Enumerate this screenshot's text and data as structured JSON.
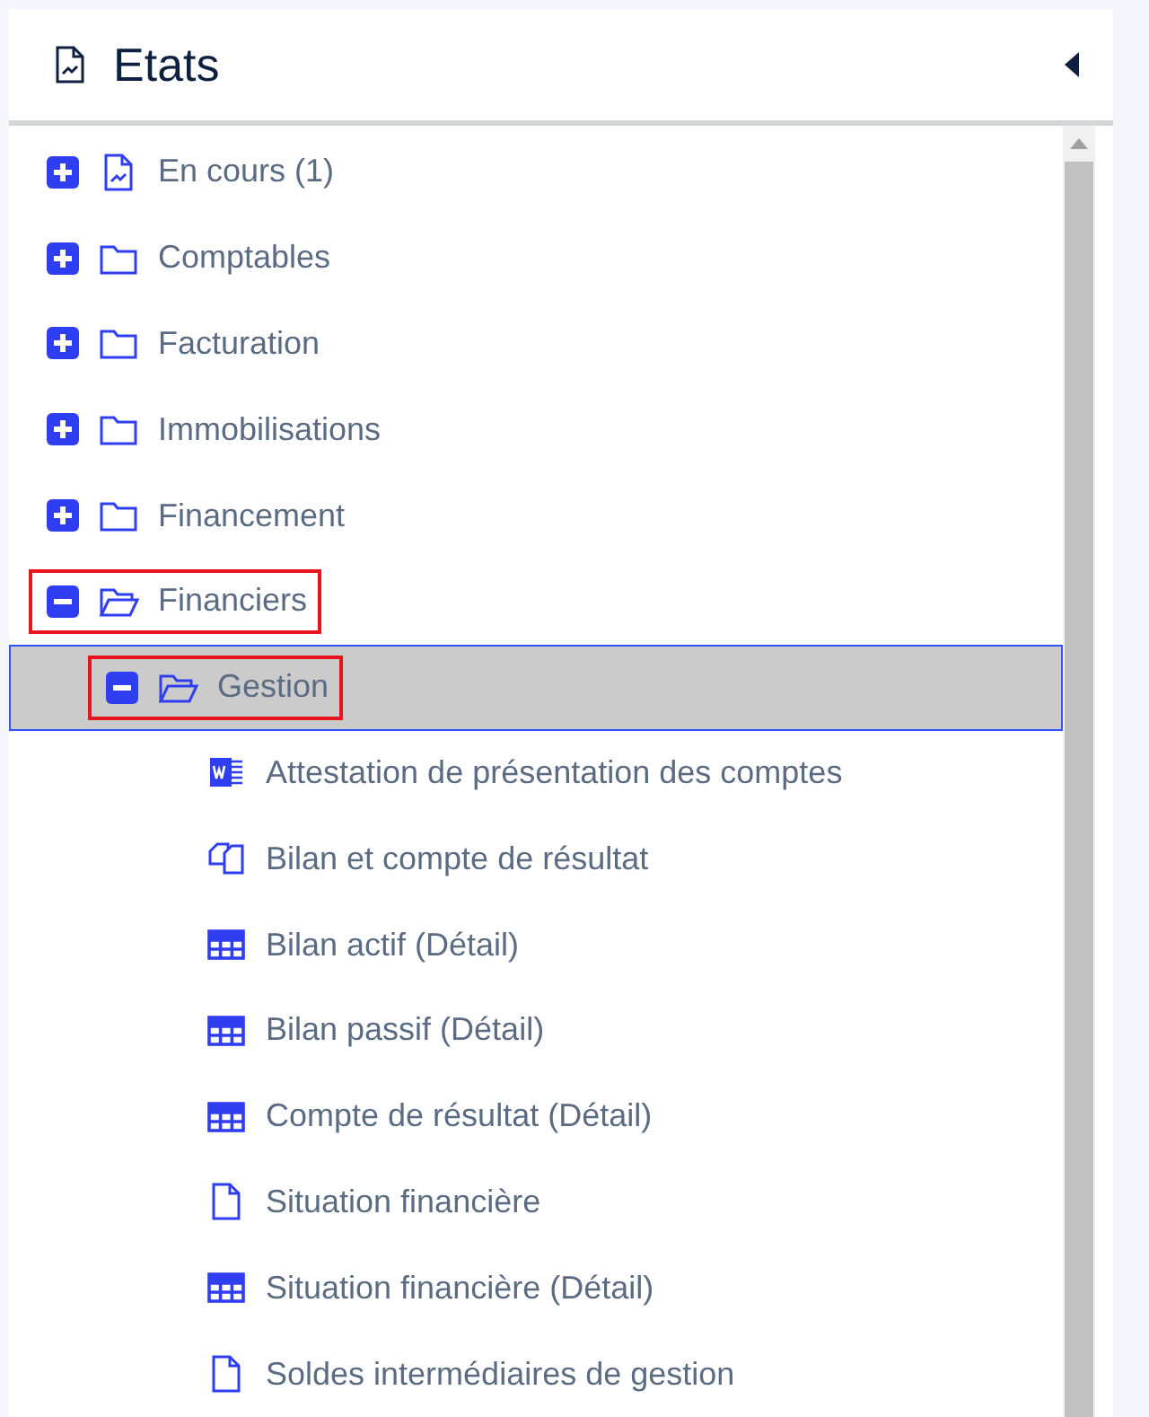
{
  "panel": {
    "title": "Etats"
  },
  "tree": [
    {
      "label": "En cours (1)",
      "kind": "report",
      "expanded": false,
      "selected": false,
      "highlighted": false
    },
    {
      "label": "Comptables",
      "kind": "folder",
      "expanded": false,
      "selected": false,
      "highlighted": false
    },
    {
      "label": "Facturation",
      "kind": "folder",
      "expanded": false,
      "selected": false,
      "highlighted": false
    },
    {
      "label": "Immobilisations",
      "kind": "folder",
      "expanded": false,
      "selected": false,
      "highlighted": false
    },
    {
      "label": "Financement",
      "kind": "folder",
      "expanded": false,
      "selected": false,
      "highlighted": false
    },
    {
      "label": "Financiers",
      "kind": "folder",
      "expanded": true,
      "selected": false,
      "highlighted": true,
      "children": [
        {
          "label": "Gestion",
          "kind": "folder",
          "expanded": true,
          "selected": true,
          "highlighted": true,
          "children": [
            {
              "label": "Attestation de présentation des comptes",
              "kind": "word",
              "selected": false,
              "highlighted": false
            },
            {
              "label": "Bilan et compte de résultat",
              "kind": "copy",
              "selected": false,
              "highlighted": false
            },
            {
              "label": "Bilan actif (Détail)",
              "kind": "table",
              "selected": false,
              "highlighted": false
            },
            {
              "label": "Bilan passif (Détail)",
              "kind": "table",
              "selected": false,
              "highlighted": false
            },
            {
              "label": "Compte de résultat (Détail)",
              "kind": "table",
              "selected": false,
              "highlighted": false
            },
            {
              "label": "Situation financière",
              "kind": "doc",
              "selected": false,
              "highlighted": false
            },
            {
              "label": "Situation financière (Détail)",
              "kind": "table",
              "selected": false,
              "highlighted": false
            },
            {
              "label": "Soldes intermédiaires de gestion",
              "kind": "doc",
              "selected": false,
              "highlighted": false
            }
          ]
        }
      ]
    }
  ]
}
